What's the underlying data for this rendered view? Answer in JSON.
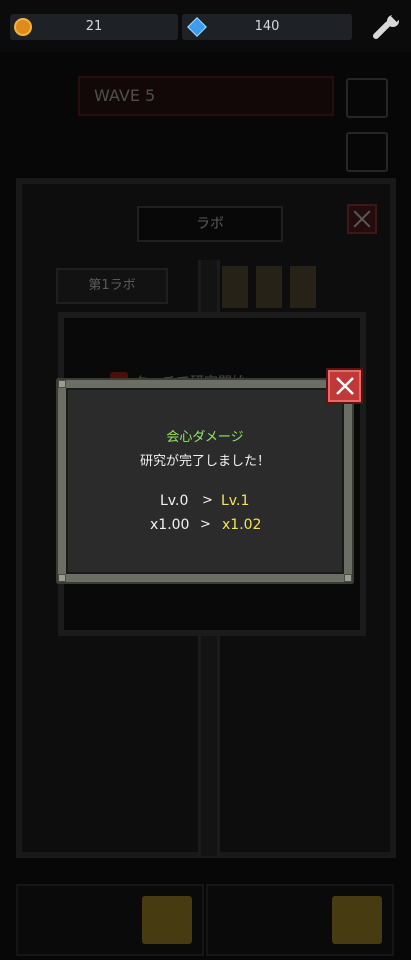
{
  "currency": {
    "coins": "21",
    "gems": "140",
    "coin_icon": "coin-icon",
    "gem_icon": "gem-icon",
    "settings_icon": "wrench-icon"
  },
  "background": {
    "wave_label": "WAVE 5",
    "lab_title": "ラボ",
    "lab_tab": "第1ラボ",
    "touch_hint": "タッチで研究開始"
  },
  "modal": {
    "title": "会心ダメージ",
    "message": "研究が完了しました！",
    "level_before": "Lv.0",
    "level_after": "Lv.1",
    "multiplier_before": "x1.00",
    "multiplier_after": "x1.02",
    "arrow": ">"
  },
  "colors": {
    "title_green": "#8fe86a",
    "upgrade_yellow": "#f6e25a",
    "close_red": "#c03838"
  }
}
